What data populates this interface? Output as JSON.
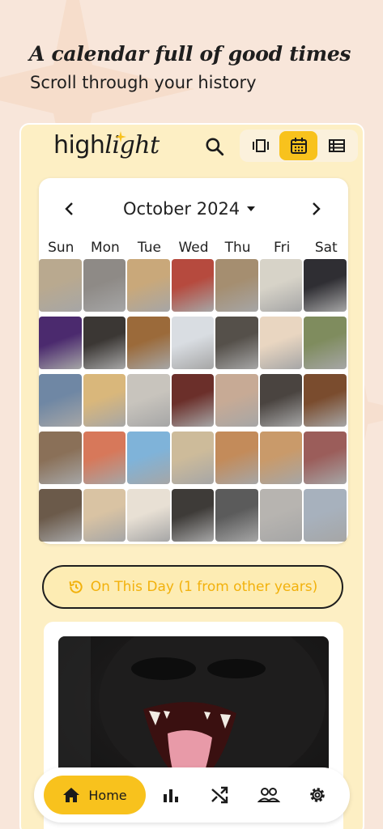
{
  "promo": {
    "headline": "A calendar full of good times",
    "subline": "Scroll through your history"
  },
  "app": {
    "logo_part1": "high",
    "logo_part2": "light",
    "search_icon": "search-icon",
    "view_modes": [
      {
        "name": "carousel-view-icon",
        "active": false
      },
      {
        "name": "calendar-view-icon",
        "active": true
      },
      {
        "name": "list-view-icon",
        "active": false
      }
    ]
  },
  "calendar": {
    "month": "October 2024",
    "weekdays": [
      "Sun",
      "Mon",
      "Tue",
      "Wed",
      "Thu",
      "Fri",
      "Sat"
    ],
    "photos": [
      [
        "#b9a98f",
        "#8e8a86",
        "#c9a87a",
        "#b64a3e",
        "#a58e70",
        "#d7d3c8",
        "#2f2e33"
      ],
      [
        "#4b2a6e",
        "#3b3734",
        "#9b6a3a",
        "#d9dde2",
        "#55504a",
        "#e9d6c1",
        "#7f8c5e"
      ],
      [
        "#6f87a4",
        "#d9b77b",
        "#c8c4bd",
        "#6b2f2a",
        "#c7aa95",
        "#4a4440",
        "#7a4c2e"
      ],
      [
        "#8a7058",
        "#d7785a",
        "#7fb3d9",
        "#cdbb9a",
        "#c38b5a",
        "#c99a6a",
        "#9b5d5a"
      ],
      [
        "#6b5a4a",
        "#d9c3a3",
        "#e8e0d4",
        "#3e3b38",
        "#5b5b5b",
        "#b7b4b0",
        "#a7b1bd"
      ]
    ]
  },
  "on_this_day": {
    "label": "On This Day (1 from other years)",
    "icon": "history-icon"
  },
  "bottom_nav": {
    "home_label": "Home",
    "items": [
      "home-icon",
      "stats-icon",
      "shuffle-icon",
      "friends-icon",
      "settings-icon"
    ]
  },
  "colors": {
    "accent": "#f8c21d",
    "panel": "#fdefc4",
    "background": "#f8e6da"
  }
}
